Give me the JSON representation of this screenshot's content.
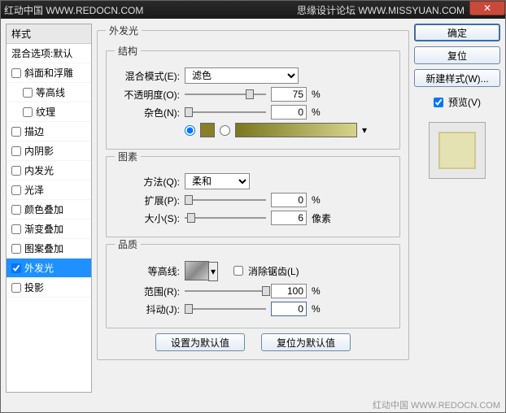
{
  "title_left": "红动中国 WWW.REDOCN.COM",
  "title_right": "思缘设计论坛 WWW.MISSYUAN.COM",
  "sidebar": {
    "header": "样式",
    "blend": "混合选项:默认",
    "items": [
      {
        "label": "斜面和浮雕",
        "checked": false
      },
      {
        "label": "等高线",
        "checked": false,
        "indent": true
      },
      {
        "label": "纹理",
        "checked": false,
        "indent": true
      },
      {
        "label": "描边",
        "checked": false
      },
      {
        "label": "内阴影",
        "checked": false
      },
      {
        "label": "内发光",
        "checked": false
      },
      {
        "label": "光泽",
        "checked": false
      },
      {
        "label": "颜色叠加",
        "checked": false
      },
      {
        "label": "渐变叠加",
        "checked": false
      },
      {
        "label": "图案叠加",
        "checked": false
      },
      {
        "label": "外发光",
        "checked": true,
        "selected": true
      },
      {
        "label": "投影",
        "checked": false
      }
    ]
  },
  "panel": {
    "title": "外发光",
    "structure": {
      "legend": "结构",
      "blend_label": "混合模式(E):",
      "blend_value": "滤色",
      "opacity_label": "不透明度(O):",
      "opacity_value": "75",
      "opacity_unit": "%",
      "noise_label": "杂色(N):",
      "noise_value": "0",
      "noise_unit": "%"
    },
    "element": {
      "legend": "图素",
      "method_label": "方法(Q):",
      "method_value": "柔和",
      "spread_label": "扩展(P):",
      "spread_value": "0",
      "spread_unit": "%",
      "size_label": "大小(S):",
      "size_value": "6",
      "size_unit": "像素"
    },
    "quality": {
      "legend": "品质",
      "contour_label": "等高线:",
      "aa_label": "消除锯齿(L)",
      "range_label": "范围(R):",
      "range_value": "100",
      "range_unit": "%",
      "jitter_label": "抖动(J):",
      "jitter_value": "0",
      "jitter_unit": "%"
    },
    "reset": "设置为默认值",
    "revert": "复位为默认值"
  },
  "buttons": {
    "ok": "确定",
    "cancel": "复位",
    "newstyle": "新建样式(W)...",
    "preview": "预览(V)"
  },
  "footer": "红动中国 WWW.REDOCN.COM"
}
